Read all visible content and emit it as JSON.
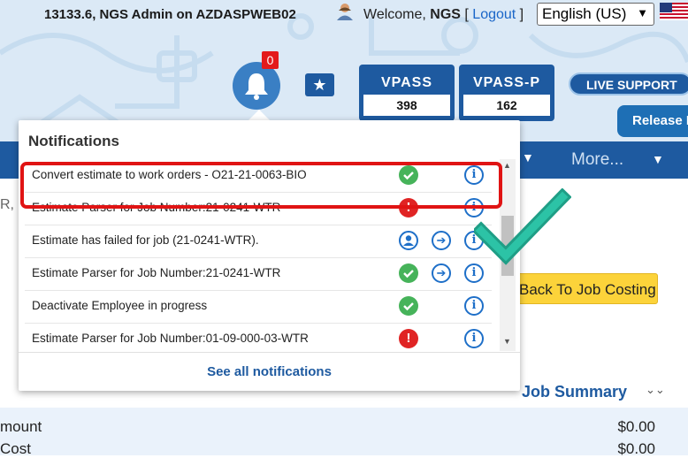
{
  "header": {
    "version_text": "13133.6, NGS Admin on AZDASPWEB02",
    "welcome_prefix": "Welcome, ",
    "welcome_user": "NGS",
    "logout_open": " [ ",
    "logout_label": "Logout",
    "logout_close": " ]",
    "language": "English (US)",
    "notification_count": "0",
    "vpass_label": "VPASS",
    "vpass_count": "398",
    "vpassp_label": "VPASS-P",
    "vpassp_count": "162",
    "live_support_label": "LIVE SUPPORT",
    "release_label": "Release N"
  },
  "nav": {
    "more_label": "More..."
  },
  "page": {
    "left_fragment": "R,",
    "back_button_label": "Back To Job Costing",
    "job_summary_title": "Job Summary",
    "summary_rows": [
      {
        "label": "mount",
        "value": "$0.00"
      },
      {
        "label": "Cost",
        "value": "$0.00"
      }
    ]
  },
  "notifications": {
    "title": "Notifications",
    "see_all_label": "See all notifications",
    "items": [
      {
        "text": "Convert estimate to work orders - O21-21-0063-BIO",
        "status": "success",
        "actions": [
          "info"
        ]
      },
      {
        "text": "Estimate Parser for Job Number:21-0241-WTR",
        "status": "error",
        "actions": [
          "info"
        ]
      },
      {
        "text": "Estimate has failed for job (21-0241-WTR).",
        "status": "user",
        "actions": [
          "arrow",
          "info"
        ]
      },
      {
        "text": "Estimate Parser for Job Number:21-0241-WTR",
        "status": "success",
        "actions": [
          "arrow",
          "info"
        ]
      },
      {
        "text": "Deactivate Employee in progress",
        "status": "success",
        "actions": [
          "info"
        ]
      },
      {
        "text": "Estimate Parser for Job Number:01-09-000-03-WTR",
        "status": "error",
        "actions": [
          "info"
        ]
      }
    ]
  },
  "colors": {
    "brand_blue": "#1e5aa0",
    "highlight_red": "#e01414",
    "success_green": "#46b35a",
    "error_red": "#e02424",
    "check_teal": "#26b39a"
  }
}
